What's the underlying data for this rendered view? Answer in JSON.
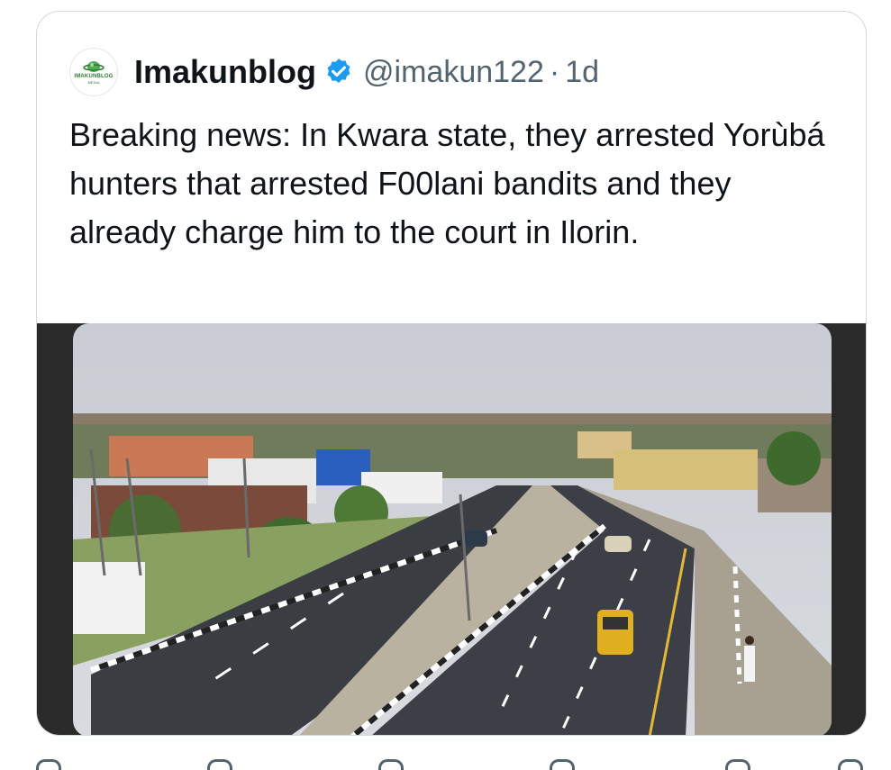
{
  "tweet": {
    "author_name": "Imakunblog",
    "handle": "@imakun122",
    "separator": "·",
    "time": "1d",
    "avatar_text": "IMAKUNBLOG",
    "avatar_subtext": "MEDIA",
    "text": "Breaking news: In Kwara state, they arrested Yorùbá hunters that arrested F00lani bandits and they already charge him to the court in Ilorin.",
    "verified_color": "#1d9bf0"
  },
  "actions": [
    {
      "icon": "reply-icon"
    },
    {
      "icon": "retweet-icon"
    },
    {
      "icon": "like-icon"
    },
    {
      "icon": "views-icon"
    },
    {
      "icon": "bookmark-icon"
    },
    {
      "icon": "share-icon"
    }
  ]
}
